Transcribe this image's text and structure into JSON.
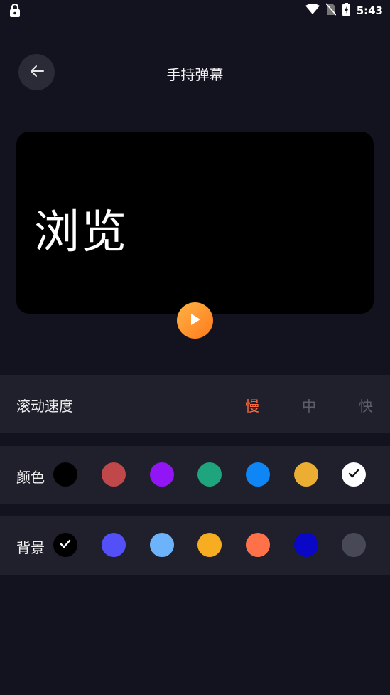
{
  "status_bar": {
    "time": "5:43",
    "icons": [
      "lock-icon",
      "wifi-icon",
      "no-sim-icon",
      "battery-icon"
    ]
  },
  "header": {
    "back_icon": "arrow-left-icon",
    "title": "手持弹幕"
  },
  "preview": {
    "text": "浏览",
    "background": "#000000",
    "text_color": "#ffffff"
  },
  "play_button": {
    "icon": "play-icon",
    "color": "#ff8a2a"
  },
  "speed": {
    "label": "滚动速度",
    "options": [
      "慢",
      "中",
      "快"
    ],
    "selected": "慢",
    "selected_color": "#ff6a3d"
  },
  "text_color": {
    "label": "颜色",
    "swatches": [
      "#000000",
      "#c0474a",
      "#9216f5",
      "#1fa57e",
      "#0f86f5",
      "#ebae33",
      "#ffffff"
    ],
    "selected_index": 6
  },
  "background": {
    "label": "背景",
    "swatches": [
      "#000000",
      "#5350f8",
      "#6db3fb",
      "#f7ad22",
      "#fe7149",
      "#0a07c6",
      "#474a56"
    ],
    "selected_index": 0
  }
}
